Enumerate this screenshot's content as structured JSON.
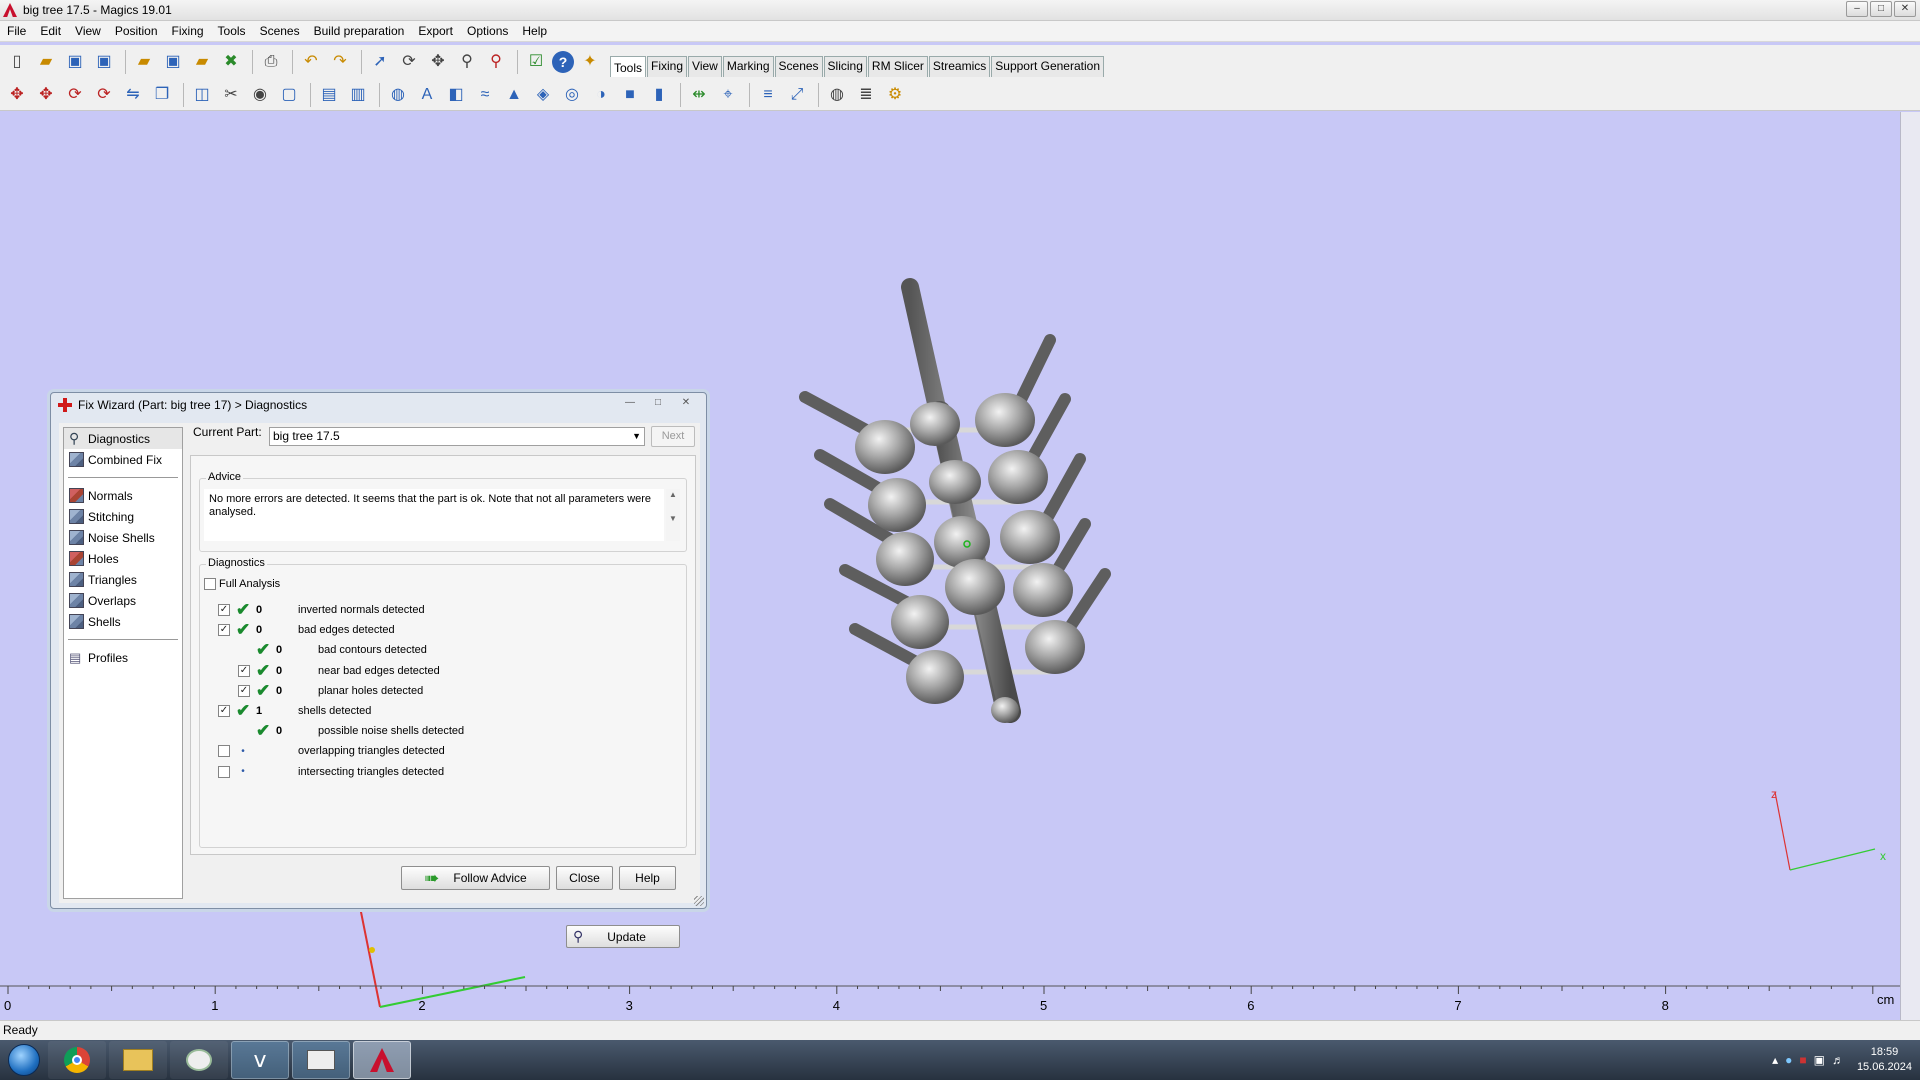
{
  "window": {
    "title": "big tree 17.5 - Magics 19.01"
  },
  "menu": [
    "File",
    "Edit",
    "View",
    "Position",
    "Fixing",
    "Tools",
    "Scenes",
    "Build preparation",
    "Export",
    "Options",
    "Help"
  ],
  "tabs": [
    "Tools",
    "Fixing",
    "View",
    "Marking",
    "Scenes",
    "Slicing",
    "RM Slicer",
    "Streamics",
    "Support Generation"
  ],
  "active_tab": "Tools",
  "toolbar_row1_icons": [
    "new-file-icon",
    "open-file-icon",
    "save-icon",
    "save-as-icon",
    "import-icon",
    "save-part-icon",
    "load-part-icon",
    "unload-part-icon",
    "print-icon",
    "undo-icon",
    "redo-icon",
    "select-icon",
    "rotate-view-icon",
    "pan-icon",
    "zoom-icon",
    "zoom-fit-icon",
    "checklist-icon",
    "help-icon",
    "wizard-icon"
  ],
  "toolbar_row2_icons": [
    "translate-icon",
    "translate-default-icon",
    "rotate-icon",
    "rotate-default-icon",
    "mirror-icon",
    "duplicate-icon",
    "unify-icon",
    "cut-icon",
    "punch-icon",
    "hollow-icon",
    "extrude-icon",
    "offset-icon",
    "perforate-icon",
    "label-icon",
    "shell-icon",
    "smooth-icon",
    "triangle-reduce-icon",
    "wrap-icon",
    "boolean-icon",
    "split-icon",
    "box-icon",
    "cylinder-icon",
    "measure-icon",
    "measure-point-icon",
    "section-icon",
    "scale-icon",
    "mesh-icon",
    "slice-icon",
    "support-icon"
  ],
  "ruler": {
    "unit": "cm",
    "labels": [
      "0",
      "1",
      "2",
      "3",
      "4",
      "5",
      "6",
      "7",
      "8"
    ]
  },
  "status": "Ready",
  "clock": {
    "time": "18:59",
    "date": "15.06.2024"
  },
  "taskbar_apps": [
    "chrome-icon",
    "explorer-icon",
    "paint-icon",
    "vbox-icon",
    "terminal-icon",
    "magics-icon"
  ],
  "wizard": {
    "title": "Fix Wizard (Part: big tree 17) > Diagnostics",
    "nav_top": [
      "Diagnostics",
      "Combined Fix"
    ],
    "nav_tools": [
      "Normals",
      "Stitching",
      "Noise Shells",
      "Holes",
      "Triangles",
      "Overlaps",
      "Shells"
    ],
    "nav_bottom": [
      "Profiles"
    ],
    "current_part_label": "Current Part:",
    "current_part": "big tree 17.5",
    "next_label": "Next",
    "advice_title": "Advice",
    "advice_text": "No more errors are detected. It seems that the part is ok. Note that not all parameters were analysed.",
    "diagnostics_title": "Diagnostics",
    "full_analysis": "Full Analysis",
    "rows": [
      {
        "checked": true,
        "status": "ok",
        "count": "0",
        "label": "inverted normals detected",
        "indent": 0
      },
      {
        "checked": true,
        "status": "ok",
        "count": "0",
        "label": "bad edges detected",
        "indent": 0
      },
      {
        "checked": null,
        "status": "ok",
        "count": "0",
        "label": "bad contours detected",
        "indent": 1
      },
      {
        "checked": true,
        "status": "ok",
        "count": "0",
        "label": "near bad edges detected",
        "indent": 1
      },
      {
        "checked": true,
        "status": "ok",
        "count": "0",
        "label": "planar holes detected",
        "indent": 1
      },
      {
        "checked": true,
        "status": "ok",
        "count": "1",
        "label": "shells detected",
        "indent": 0
      },
      {
        "checked": null,
        "status": "ok",
        "count": "0",
        "label": "possible noise shells detected",
        "indent": 1
      },
      {
        "checked": false,
        "status": "none",
        "count": "",
        "label": "overlapping triangles detected",
        "indent": 0
      },
      {
        "checked": false,
        "status": "none",
        "count": "",
        "label": "intersecting triangles detected",
        "indent": 0
      }
    ],
    "update_label": "Update",
    "follow_advice_label": "Follow Advice",
    "close_label": "Close",
    "help_label": "Help"
  },
  "axes_triad": {
    "labels": [
      "z",
      "x"
    ]
  }
}
